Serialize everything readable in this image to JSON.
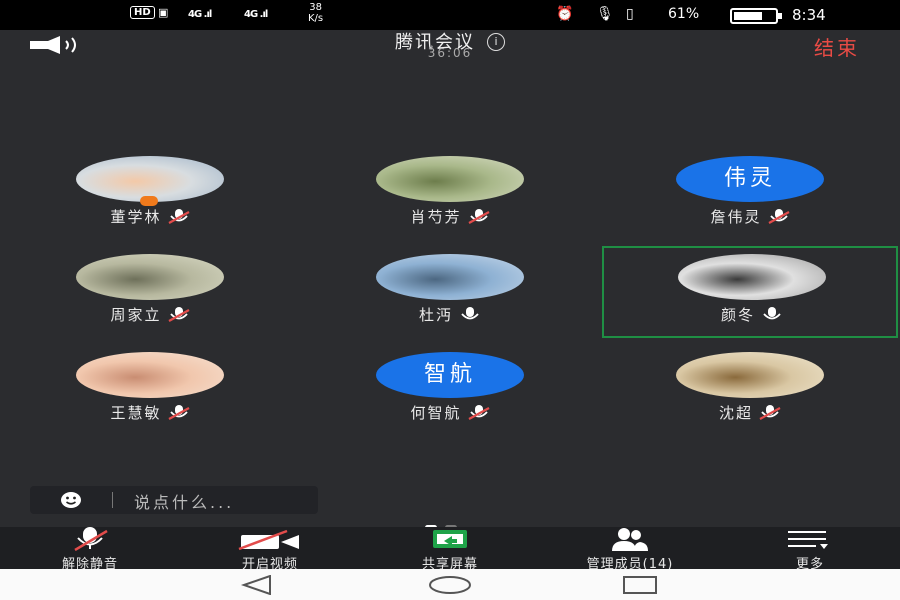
{
  "status_bar": {
    "hd": "HD",
    "signal1": "4G .ıl",
    "signal2": "4G .ıl",
    "net_speed_value": "38",
    "net_speed_unit": "K/s",
    "battery": "61%",
    "time": "8:34"
  },
  "header": {
    "title": "腾讯会议",
    "timer": "36:06",
    "end_label": "结束",
    "info_icon": "i"
  },
  "participants": [
    {
      "name": "董学林",
      "avatar_type": "photo",
      "avatar_colors": [
        "#d8dde0",
        "#f3c9a8",
        "#9fb3c8"
      ],
      "mic": "muted",
      "host": true
    },
    {
      "name": "肖芍芳",
      "avatar_type": "photo",
      "avatar_colors": [
        "#a9b88a",
        "#6d7d4c",
        "#d7dcc4"
      ],
      "mic": "muted",
      "host": false
    },
    {
      "name": "詹伟灵",
      "avatar_type": "text",
      "avatar_text": "伟灵",
      "mic": "muted",
      "host": false
    },
    {
      "name": "周家立",
      "avatar_type": "photo",
      "avatar_colors": [
        "#b7b89f",
        "#6e705a",
        "#d9dac6"
      ],
      "mic": "muted",
      "host": false
    },
    {
      "name": "杜沔",
      "avatar_type": "photo",
      "avatar_colors": [
        "#8eb1d3",
        "#4c6781",
        "#c7d8ea"
      ],
      "mic": "on",
      "host": false
    },
    {
      "name": "颜冬",
      "avatar_type": "photo",
      "avatar_colors": [
        "#e0e0e0",
        "#3a3a3a",
        "#9b9b9b"
      ],
      "mic": "on",
      "host": false,
      "selected": true
    },
    {
      "name": "王慧敏",
      "avatar_type": "photo",
      "avatar_colors": [
        "#f1c7ad",
        "#c98d72",
        "#f6e2d3"
      ],
      "mic": "muted",
      "host": false
    },
    {
      "name": "何智航",
      "avatar_type": "text",
      "avatar_text": "智航",
      "mic": "muted",
      "host": false
    },
    {
      "name": "沈超",
      "avatar_type": "photo",
      "avatar_colors": [
        "#d9c7a3",
        "#8a6a3c",
        "#efe6d0"
      ],
      "mic": "muted",
      "host": false
    }
  ],
  "chat": {
    "placeholder": "说点什么..."
  },
  "page_dots": {
    "active_index": 0,
    "count": 2
  },
  "toolbar": {
    "unmute_label": "解除静音",
    "video_label": "开启视频",
    "share_label": "共享屏幕",
    "manage_label": "管理成员(14)",
    "more_label": "更多"
  },
  "colors": {
    "background": "#2b2c2f",
    "accent_blue": "#1a73e8",
    "end_red": "#e94b45",
    "share_green": "#1fa349",
    "muted_red": "#e24c4b",
    "selected_border": "#1f8f44"
  },
  "icons": {
    "speaker": "speaker-icon",
    "info": "info-icon",
    "mic_muted": "mic-muted-icon",
    "mic_on": "mic-icon",
    "smile": "smile-icon",
    "video_off": "video-off-icon",
    "share_screen": "share-screen-icon",
    "members": "members-icon",
    "menu": "menu-icon",
    "nav_back": "nav-back-icon",
    "nav_home": "nav-home-icon",
    "nav_recents": "nav-recents-icon"
  }
}
